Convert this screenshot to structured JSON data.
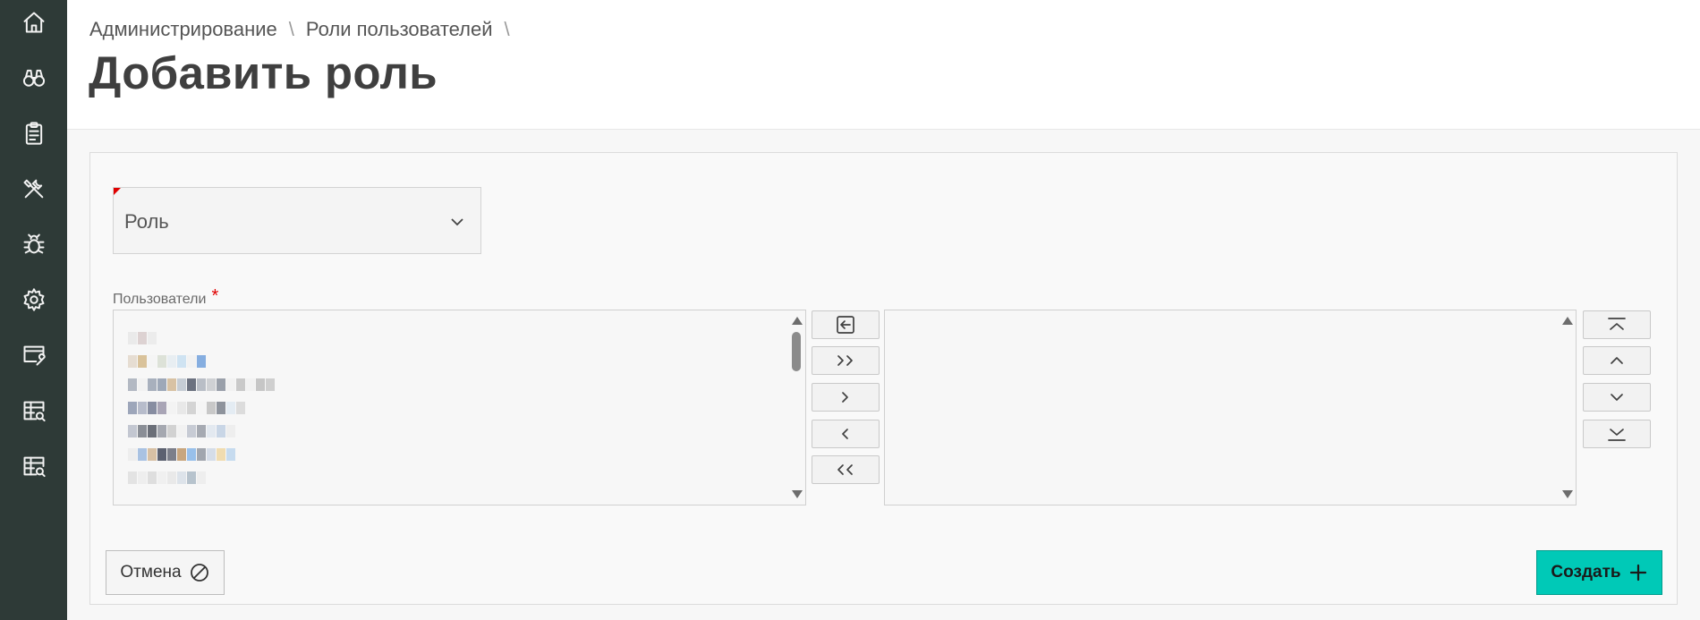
{
  "sidebar": {
    "items": [
      {
        "icon": "home-icon"
      },
      {
        "icon": "binoculars-icon"
      },
      {
        "icon": "clipboard-icon"
      },
      {
        "icon": "tools-icon"
      },
      {
        "icon": "bug-icon"
      },
      {
        "icon": "gear-icon"
      },
      {
        "icon": "monitor-wrench-icon"
      },
      {
        "icon": "table-search-icon"
      },
      {
        "icon": "table-search-icon"
      }
    ]
  },
  "breadcrumb": {
    "items": [
      "Администрирование",
      "Роли пользователей"
    ],
    "separator": "\\"
  },
  "page": {
    "title": "Добавить роль"
  },
  "form": {
    "role_select": {
      "placeholder": "Роль",
      "required": true
    },
    "users": {
      "label": "Пользователи",
      "required_mark": "*"
    }
  },
  "shuttle": {
    "left_items_count_visible": 7,
    "right_items": [],
    "move_buttons": [
      "reset-icon",
      "move-all-right-icon",
      "move-right-icon",
      "move-left-icon",
      "move-all-left-icon"
    ],
    "order_buttons": [
      "move-top-icon",
      "move-up-icon",
      "move-down-icon",
      "move-bottom-icon"
    ]
  },
  "actions": {
    "cancel_label": "Отмена",
    "create_label": "Создать"
  },
  "colors": {
    "sidebar_bg": "#2e3a37",
    "primary_button": "#00c9b7",
    "required": "#e00000"
  }
}
